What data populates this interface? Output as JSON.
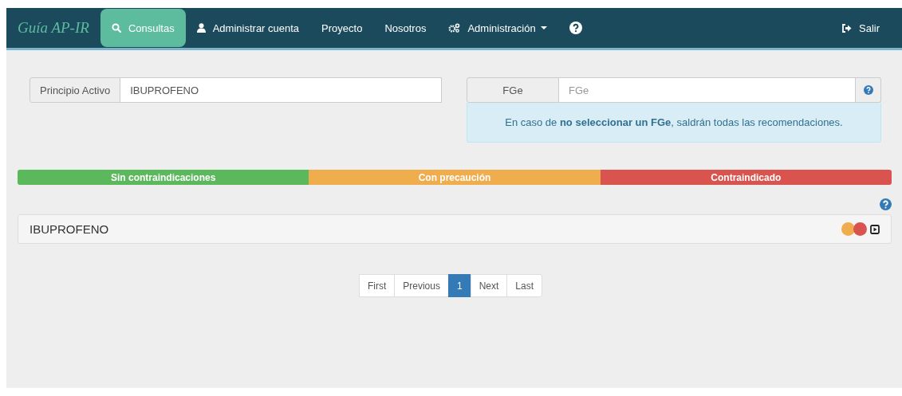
{
  "navbar": {
    "brand": "Guía AP-IR",
    "items": [
      {
        "kind": "search",
        "label": "Consultas",
        "selected": true
      },
      {
        "kind": "user",
        "label": "Administrar cuenta",
        "selected": false
      },
      {
        "kind": "plain",
        "label": "Proyecto",
        "selected": false
      },
      {
        "kind": "plain",
        "label": "Nosotros",
        "selected": false
      },
      {
        "kind": "gears",
        "label": "Administración",
        "selected": false,
        "dropdown": true
      },
      {
        "kind": "help",
        "selected": false
      }
    ],
    "logout": {
      "label": "Salir"
    }
  },
  "search": {
    "principio_activo": {
      "label": "Principio Activo",
      "value": "IBUPROFENO"
    },
    "fge": {
      "label": "FGe",
      "placeholder": "FGe"
    },
    "info": "En caso de **no seleccionar un FGe**, saldrán todas las recomendaciones."
  },
  "legend": [
    {
      "label": "Sin contraindicaciones",
      "color": "#5cb85c"
    },
    {
      "label": "Con precaución",
      "color": "#f0ad4e"
    },
    {
      "label": "Contraindicado",
      "color": "#d9534f"
    }
  ],
  "results": [
    {
      "name": "IBUPROFENO",
      "indicators": [
        {
          "color": "#f0ad4e"
        },
        {
          "color": "#d9534f"
        }
      ]
    }
  ],
  "pagination": [
    {
      "label": "First",
      "selected": false
    },
    {
      "label": "Previous",
      "selected": false
    },
    {
      "label": "1",
      "selected": true
    },
    {
      "label": "Next",
      "selected": false
    },
    {
      "label": "Last",
      "selected": false
    }
  ]
}
